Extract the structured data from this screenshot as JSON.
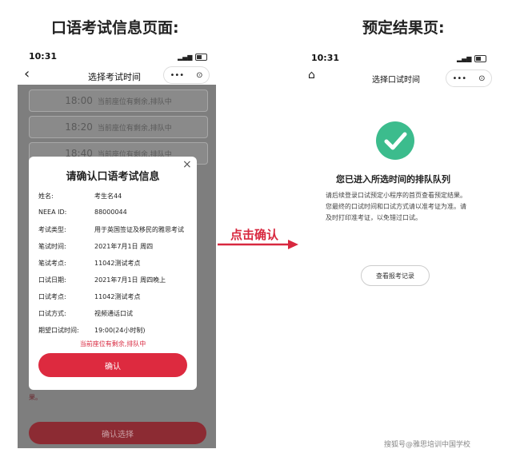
{
  "headings": {
    "left": "口语考试信息页面:",
    "right": "预定结果页:"
  },
  "left_phone": {
    "status_time": "10:31",
    "back_icon": "‹",
    "nav_title": "选择考试时间",
    "capsule_more": "•••",
    "capsule_close": "⊙",
    "slots": [
      {
        "time": "18:00",
        "status": "当前座位有剩余,排队中"
      },
      {
        "time": "18:20",
        "status": "当前座位有剩余,排队中"
      },
      {
        "time": "18:40",
        "status": "当前座位有剩余,排队中"
      }
    ],
    "modal": {
      "close": "×",
      "title": "请确认口语考试信息",
      "rows": [
        {
          "label": "姓名:",
          "value": "考生名44"
        },
        {
          "label": "NEEA ID:",
          "value": "88000044"
        },
        {
          "label": "考试类型:",
          "value": "用于英国签证及移民的雅思考试"
        },
        {
          "label": "笔试时间:",
          "value": "2021年7月1日 周四"
        },
        {
          "label": "笔试考点:",
          "value": "11042测试考点"
        },
        {
          "label": "口试日期:",
          "value": "2021年7月1日 周四晚上"
        },
        {
          "label": "口试考点:",
          "value": "11042测试考点"
        },
        {
          "label": "口试方式:",
          "value": "视频通话口试"
        },
        {
          "label": "期望口试时间:",
          "value": "19:00(24小时制)"
        }
      ],
      "notice": "当前座位有剩余,排队中",
      "confirm_label": "确认"
    },
    "behind_text": "果。",
    "bottom_button": "确认选择"
  },
  "arrow_label": "点击确认",
  "right_phone": {
    "status_time": "10:31",
    "home_icon": "⌂",
    "nav_title": "选择口试时间",
    "capsule_more": "•••",
    "capsule_close": "⊙",
    "success_icon": "check-circle-icon",
    "result_title": "您已进入所选时间的排队队列",
    "result_desc": "请后续登录口试预定小程序的首页查看预定结果。您最终的口试时间和口试方式请以准考证为准。请及时打印准考证，以免错过口试。",
    "record_button": "查看报考记录"
  },
  "watermark": "搜狐号@雅思培训中国学校",
  "colors": {
    "accent_red": "#dd2a3f",
    "success_green": "#3cbc8d"
  }
}
